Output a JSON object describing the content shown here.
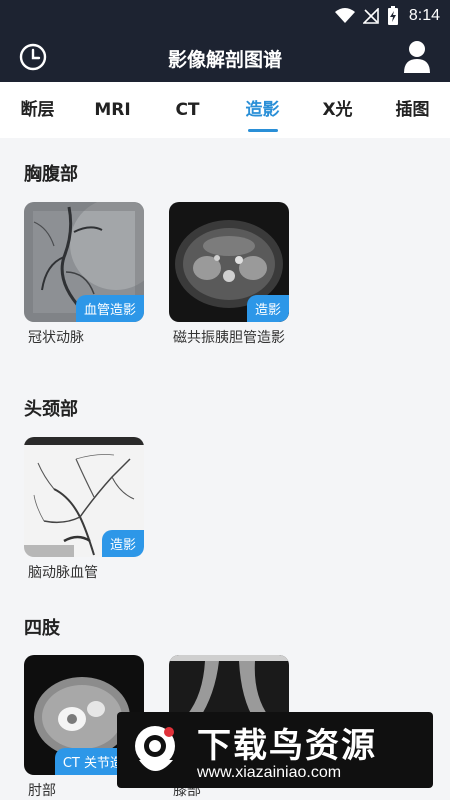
{
  "status_bar": {
    "time": "8:14"
  },
  "app_bar": {
    "title": "影像解剖图谱"
  },
  "tabs": [
    {
      "label": "断层",
      "active": false
    },
    {
      "label": "MRI",
      "active": false
    },
    {
      "label": "CT",
      "active": false
    },
    {
      "label": "造影",
      "active": true
    },
    {
      "label": "X光",
      "active": false
    },
    {
      "label": "插图",
      "active": false
    }
  ],
  "sections": [
    {
      "title": "胸腹部",
      "cards": [
        {
          "tag": "血管造影",
          "label": "冠状动脉"
        },
        {
          "tag": "造影",
          "label": "磁共振胰胆管造影"
        }
      ]
    },
    {
      "title": "头颈部",
      "cards": [
        {
          "tag": "造影",
          "label": "脑动脉血管"
        }
      ]
    },
    {
      "title": "四肢",
      "cards": [
        {
          "tag": "CT 关节造影",
          "label": "肘部"
        },
        {
          "tag": "",
          "label": "膝部"
        }
      ]
    }
  ],
  "watermark": {
    "brand": "下载鸟资源",
    "url": "www.xiazainiao.com"
  },
  "colors": {
    "header_bg": "#1d2331",
    "accent": "#2a8fd7",
    "tag_bg": "#2d97e8"
  }
}
